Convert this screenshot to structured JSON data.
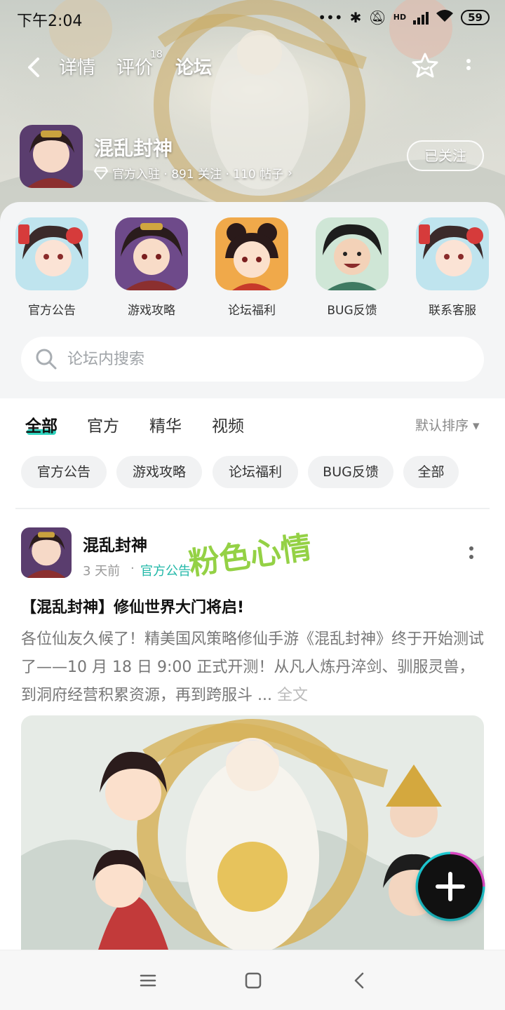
{
  "status_bar": {
    "time": "下午2:04",
    "battery": "59",
    "hd_label": "HD"
  },
  "topnav": {
    "tabs": [
      {
        "label": "详情"
      },
      {
        "label": "评价",
        "badge": "18"
      },
      {
        "label": "论坛",
        "active": true
      }
    ]
  },
  "game": {
    "name": "混乱封神",
    "meta": "官方入驻 · 891 关注 · 110 帖子",
    "follow_label": "已关注"
  },
  "quick_entries": [
    {
      "label": "官方公告"
    },
    {
      "label": "游戏攻略"
    },
    {
      "label": "论坛福利"
    },
    {
      "label": "BUG反馈"
    },
    {
      "label": "联系客服"
    }
  ],
  "search": {
    "placeholder": "论坛内搜索"
  },
  "filter_tabs": [
    {
      "label": "全部",
      "active": true
    },
    {
      "label": "官方"
    },
    {
      "label": "精华"
    },
    {
      "label": "视频"
    }
  ],
  "sort": {
    "label": "默认排序 ▾"
  },
  "chips": [
    {
      "label": "官方公告"
    },
    {
      "label": "游戏攻略"
    },
    {
      "label": "论坛福利"
    },
    {
      "label": "BUG反馈"
    },
    {
      "label": "全部"
    }
  ],
  "post": {
    "author": "混乱封神",
    "time": "3 天前",
    "dot": "·",
    "category": "官方公告",
    "watermark": "粉色心情",
    "title": "【混乱封神】修仙世界大门将启!",
    "body": "各位仙友久候了！精美国风策略修仙手游《混乱封神》终于开始测试了——10 月 18 日 9:00 正式开测！从凡人炼丹淬剑、驯服灵兽，到洞府经营积累资源，再到跨服斗 ...",
    "fulltext_label": "全文"
  },
  "colors": {
    "accent": "#2fd3be",
    "category": "#22b8a8"
  }
}
